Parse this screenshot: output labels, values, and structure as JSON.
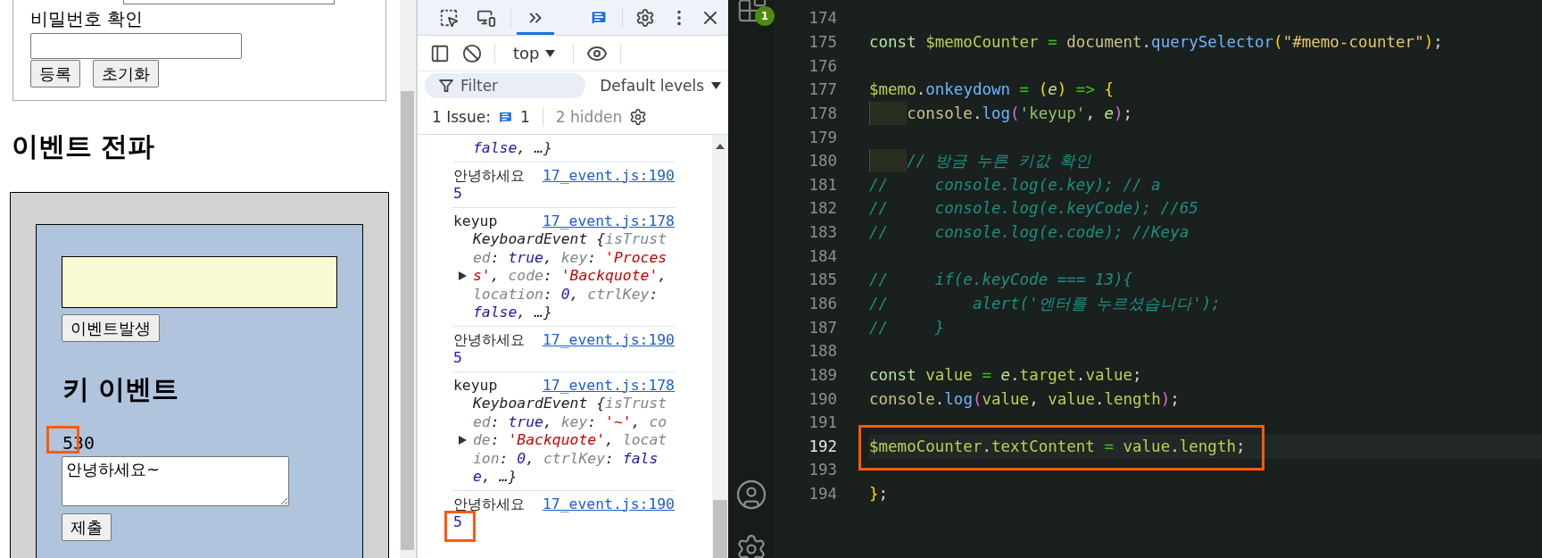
{
  "page": {
    "signup_form": {
      "password_confirm_label": "비밀번호 확인",
      "buttons": [
        {
          "label": "등록"
        },
        {
          "label": "초기화"
        }
      ]
    },
    "propagation_heading": "이벤트 전파",
    "event_button": "이벤트발생",
    "key_heading": "키 이벤트",
    "counter": {
      "text": "530",
      "annotated": true
    },
    "memo": {
      "value": "안녕하세요~"
    },
    "submit_button": "제출"
  },
  "devtools": {
    "tabs": [
      {
        "kind": "inspect",
        "selected": false
      },
      {
        "kind": "device",
        "selected": false
      },
      {
        "kind": "more",
        "selected": true
      }
    ],
    "context": "top",
    "filter_placeholder": "Filter",
    "levels": "Default levels",
    "issues": {
      "label": "1 Issue:",
      "count": "1",
      "hidden": "2 hidden"
    },
    "messages": [
      {
        "object_lines": [
          {
            "kind": "plain",
            "tokens": [
              {
                "kind": "bool",
                "text": "false"
              },
              {
                "kind": "plain",
                "text": ", …}"
              }
            ]
          }
        ]
      },
      {
        "text": "안녕하세요",
        "source": "17_event.js:190",
        "value": "5",
        "annotated": false
      },
      {
        "text": "keyup",
        "source": "17_event.js:178",
        "object_lines": [
          {
            "kind": "plain",
            "tokens": [
              {
                "kind": "plain",
                "text": "KeyboardEvent {"
              },
              {
                "kind": "key",
                "text": "isTrust"
              }
            ]
          },
          {
            "kind": "plain",
            "tokens": [
              {
                "kind": "key",
                "text": "ed"
              },
              {
                "kind": "plain",
                "text": ": "
              },
              {
                "kind": "bool",
                "text": "true"
              },
              {
                "kind": "plain",
                "text": ", "
              },
              {
                "kind": "key",
                "text": "key"
              },
              {
                "kind": "plain",
                "text": ": "
              },
              {
                "kind": "str",
                "text": "'Proces"
              }
            ]
          },
          {
            "kind": "toggle",
            "tokens": [
              {
                "kind": "str",
                "text": "s'"
              },
              {
                "kind": "plain",
                "text": ", "
              },
              {
                "kind": "key",
                "text": "code"
              },
              {
                "kind": "plain",
                "text": ": "
              },
              {
                "kind": "str",
                "text": "'Backquote'"
              },
              {
                "kind": "plain",
                "text": ","
              }
            ]
          },
          {
            "kind": "plain",
            "tokens": [
              {
                "kind": "key",
                "text": "location"
              },
              {
                "kind": "plain",
                "text": ": "
              },
              {
                "kind": "bool",
                "text": "0"
              },
              {
                "kind": "plain",
                "text": ", "
              },
              {
                "kind": "key",
                "text": "ctrlKey"
              },
              {
                "kind": "plain",
                "text": ":"
              }
            ]
          },
          {
            "kind": "plain",
            "tokens": [
              {
                "kind": "bool",
                "text": "false"
              },
              {
                "kind": "plain",
                "text": ", …}"
              }
            ]
          }
        ]
      },
      {
        "text": "안녕하세요",
        "source": "17_event.js:190",
        "value": "5",
        "annotated": false
      },
      {
        "text": "keyup",
        "source": "17_event.js:178",
        "object_lines": [
          {
            "kind": "plain",
            "tokens": [
              {
                "kind": "plain",
                "text": "KeyboardEvent {"
              },
              {
                "kind": "key",
                "text": "isTrust"
              }
            ]
          },
          {
            "kind": "plain",
            "tokens": [
              {
                "kind": "key",
                "text": "ed"
              },
              {
                "kind": "plain",
                "text": ": "
              },
              {
                "kind": "bool",
                "text": "true"
              },
              {
                "kind": "plain",
                "text": ", "
              },
              {
                "kind": "key",
                "text": "key"
              },
              {
                "kind": "plain",
                "text": ": "
              },
              {
                "kind": "str",
                "text": "'~'"
              },
              {
                "kind": "plain",
                "text": ", "
              },
              {
                "kind": "key",
                "text": "co"
              }
            ]
          },
          {
            "kind": "toggle",
            "tokens": [
              {
                "kind": "key",
                "text": "de"
              },
              {
                "kind": "plain",
                "text": ": "
              },
              {
                "kind": "str",
                "text": "'Backquote'"
              },
              {
                "kind": "plain",
                "text": ", "
              },
              {
                "kind": "key",
                "text": "locat"
              }
            ]
          },
          {
            "kind": "plain",
            "tokens": [
              {
                "kind": "key",
                "text": "ion"
              },
              {
                "kind": "plain",
                "text": ": "
              },
              {
                "kind": "bool",
                "text": "0"
              },
              {
                "kind": "plain",
                "text": ", "
              },
              {
                "kind": "key",
                "text": "ctrlKey"
              },
              {
                "kind": "plain",
                "text": ": "
              },
              {
                "kind": "bool",
                "text": "fals"
              }
            ]
          },
          {
            "kind": "plain",
            "tokens": [
              {
                "kind": "bool",
                "text": "e"
              },
              {
                "kind": "plain",
                "text": ", …}"
              }
            ]
          }
        ]
      },
      {
        "text": "안녕하세요",
        "source": "17_event.js:190",
        "value": "5",
        "annotated": true
      }
    ]
  },
  "editor": {
    "badge": "1",
    "lines": [
      {
        "number": "174",
        "current": false,
        "annotated": false
      },
      {
        "number": "175",
        "current": false,
        "annotated": false,
        "tokens": [
          {
            "kind": "kw",
            "text": "const "
          },
          {
            "kind": "var",
            "text": "$memoCounter"
          },
          {
            "kind": "op",
            "text": " = "
          },
          {
            "kind": "obj",
            "text": "document"
          },
          {
            "kind": "punc",
            "text": "."
          },
          {
            "kind": "fn",
            "text": "querySelector"
          },
          {
            "kind": "brace",
            "text": "("
          },
          {
            "kind": "str",
            "text": "\"#memo-counter\""
          },
          {
            "kind": "brace",
            "text": ")"
          },
          {
            "kind": "punc",
            "text": ";"
          }
        ]
      },
      {
        "number": "176",
        "current": false,
        "annotated": false
      },
      {
        "number": "177",
        "current": false,
        "annotated": false,
        "tokens": [
          {
            "kind": "var",
            "text": "$memo"
          },
          {
            "kind": "punc",
            "text": "."
          },
          {
            "kind": "fn",
            "text": "onkeydown"
          },
          {
            "kind": "op",
            "text": " = "
          },
          {
            "kind": "brace",
            "text": "("
          },
          {
            "kind": "param",
            "text": "e"
          },
          {
            "kind": "brace",
            "text": ")"
          },
          {
            "kind": "op",
            "text": " => "
          },
          {
            "kind": "brace",
            "text": "{"
          }
        ]
      },
      {
        "number": "178",
        "current": false,
        "annotated": false,
        "indented": true,
        "tokens": [
          {
            "kind": "obj",
            "text": "console"
          },
          {
            "kind": "punc",
            "text": "."
          },
          {
            "kind": "fn",
            "text": "log"
          },
          {
            "kind": "paren",
            "text": "("
          },
          {
            "kind": "str_alt",
            "text": "'keyup'"
          },
          {
            "kind": "punc",
            "text": ", "
          },
          {
            "kind": "param",
            "text": "e"
          },
          {
            "kind": "paren",
            "text": ")"
          },
          {
            "kind": "punc",
            "text": ";"
          }
        ]
      },
      {
        "number": "179",
        "current": false,
        "annotated": false
      },
      {
        "number": "180",
        "current": false,
        "annotated": false,
        "indented": true,
        "tokens": [
          {
            "kind": "comment",
            "text": "// 방금 누른 키값 확인"
          }
        ]
      },
      {
        "number": "181",
        "current": false,
        "annotated": false,
        "tokens": [
          {
            "kind": "comment",
            "text": "//     console.log(e.key); // a"
          }
        ]
      },
      {
        "number": "182",
        "current": false,
        "annotated": false,
        "tokens": [
          {
            "kind": "comment",
            "text": "//     console.log(e.keyCode); //65"
          }
        ]
      },
      {
        "number": "183",
        "current": false,
        "annotated": false,
        "tokens": [
          {
            "kind": "comment",
            "text": "//     console.log(e.code); //Keya"
          }
        ]
      },
      {
        "number": "184",
        "current": false,
        "annotated": false
      },
      {
        "number": "185",
        "current": false,
        "annotated": false,
        "tokens": [
          {
            "kind": "comment",
            "text": "//     if(e.keyCode === 13){"
          }
        ]
      },
      {
        "number": "186",
        "current": false,
        "annotated": false,
        "tokens": [
          {
            "kind": "comment",
            "text": "//         alert('엔터를 누르셨습니다');"
          }
        ]
      },
      {
        "number": "187",
        "current": false,
        "annotated": false,
        "tokens": [
          {
            "kind": "comment",
            "text": "//     }"
          }
        ]
      },
      {
        "number": "188",
        "current": false,
        "annotated": false
      },
      {
        "number": "189",
        "current": false,
        "annotated": false,
        "tokens": [
          {
            "kind": "kw",
            "text": "const "
          },
          {
            "kind": "var",
            "text": "value"
          },
          {
            "kind": "op",
            "text": " = "
          },
          {
            "kind": "param",
            "text": "e"
          },
          {
            "kind": "punc",
            "text": "."
          },
          {
            "kind": "prop",
            "text": "target"
          },
          {
            "kind": "punc",
            "text": "."
          },
          {
            "kind": "prop",
            "text": "value"
          },
          {
            "kind": "punc",
            "text": ";"
          }
        ]
      },
      {
        "number": "190",
        "current": false,
        "annotated": false,
        "tokens": [
          {
            "kind": "obj",
            "text": "console"
          },
          {
            "kind": "punc",
            "text": "."
          },
          {
            "kind": "fn",
            "text": "log"
          },
          {
            "kind": "paren",
            "text": "("
          },
          {
            "kind": "prop",
            "text": "value"
          },
          {
            "kind": "punc",
            "text": ", "
          },
          {
            "kind": "prop",
            "text": "value"
          },
          {
            "kind": "punc",
            "text": "."
          },
          {
            "kind": "prop",
            "text": "length"
          },
          {
            "kind": "paren",
            "text": ")"
          },
          {
            "kind": "punc",
            "text": ";"
          }
        ]
      },
      {
        "number": "191",
        "current": false,
        "annotated": false
      },
      {
        "number": "192",
        "current": true,
        "annotated": true,
        "tokens": [
          {
            "kind": "var",
            "text": "$memoCounter"
          },
          {
            "kind": "punc",
            "text": "."
          },
          {
            "kind": "prop",
            "text": "textContent"
          },
          {
            "kind": "op",
            "text": " = "
          },
          {
            "kind": "prop",
            "text": "value"
          },
          {
            "kind": "punc",
            "text": "."
          },
          {
            "kind": "prop",
            "text": "length"
          },
          {
            "kind": "punc",
            "text": ";"
          }
        ]
      },
      {
        "number": "193",
        "current": false,
        "annotated": false
      },
      {
        "number": "194",
        "current": false,
        "annotated": false,
        "tokens": [
          {
            "kind": "brace",
            "text": "}"
          },
          {
            "kind": "punc",
            "text": ";"
          }
        ]
      }
    ]
  }
}
